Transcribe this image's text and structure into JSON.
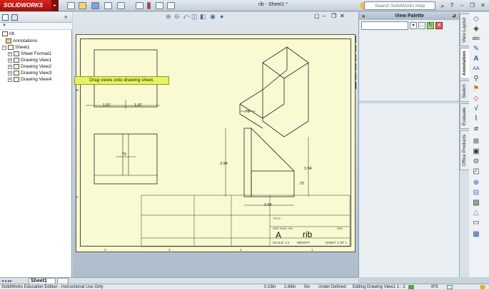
{
  "app": {
    "logo_text": "SOLIDWORKS",
    "document_title": "rib - Sheet1 *"
  },
  "search": {
    "placeholder": "Search SolidWorks Help"
  },
  "tree": {
    "root": "rib",
    "items": [
      {
        "label": "Annotations"
      },
      {
        "label": "Sheet1"
      },
      {
        "label": "Sheet Format1"
      },
      {
        "label": "Drawing View1"
      },
      {
        "label": "Drawing View2"
      },
      {
        "label": "Drawing View3"
      },
      {
        "label": "Drawing View4"
      }
    ]
  },
  "palette": {
    "title": "View Palette",
    "drop_hint": "Drag views onto drawing sheet."
  },
  "side_tabs": [
    "View Layout",
    "Annotation",
    "Sketch",
    "Evaluate",
    "Office Products"
  ],
  "drawing": {
    "dim_front_left": "1.97",
    "dim_front_right": "1.97",
    "dim_top_width": ".79",
    "dim_side_top": ".79",
    "dim_height_left": "3.94",
    "dim_height_right": "3.94",
    "dim_bottom": "3.94",
    "dim_step": ".79",
    "title_name": "rib",
    "size_label": "A",
    "size_caption": "SIZE",
    "dwg_caption": "DWG. NO.",
    "rev_caption": "REV",
    "scale_text": "SCALE: 1:2",
    "weight_text": "WEIGHT:",
    "sheet_text": "SHEET 1 OF 1",
    "title_caption": "TITLE:",
    "zone_cols": [
      "4",
      "3",
      "2",
      "1"
    ],
    "zone_rows": [
      "B",
      "A"
    ]
  },
  "sheet_tab": {
    "label": "Sheet1"
  },
  "status": {
    "edition": "SolidWorks Education Edition - Instructional Use Only",
    "x": "0.19in",
    "y": "2.68in",
    "z": "0in",
    "state": "Under Defined",
    "editing": "Editing Drawing View1",
    "scale": "1 : 2",
    "units": "IPS"
  },
  "colors": {
    "logo_red": "#c81e1a",
    "sheet_fill": "#fafad2",
    "drop_hint": "#e7f25e"
  }
}
